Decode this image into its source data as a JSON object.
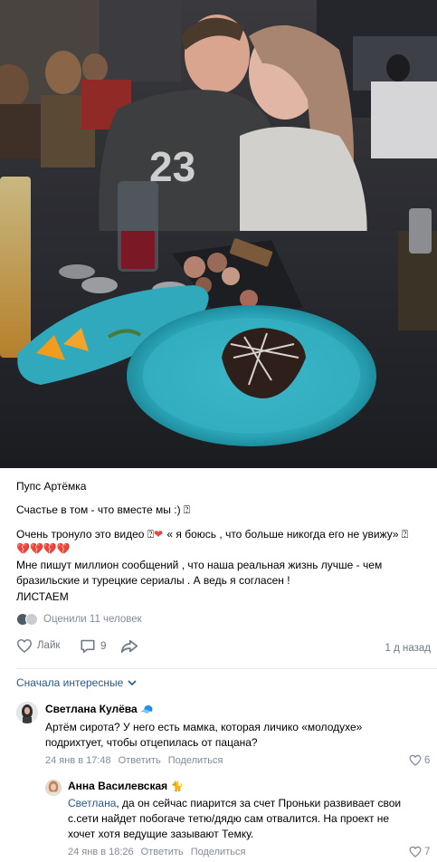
{
  "photo": {
    "alt_icon": "photo-image"
  },
  "post": {
    "author": "Пупс Артёмка",
    "lines": [
      "Счастье в том - что вместе мы :) ⍰",
      "Очень тронуло это видео ⍰",
      "« я боюсь , что больше никогда его не увижу» ⍰",
      "💔💔💔💔",
      "Мне пишут миллион сообщений , что наша реальная жизнь лучше - чем",
      "бразильские и турецкие сериалы . А ведь я согласен !",
      "ЛИСТАЕМ"
    ],
    "likes_summary": "Оценили 11 человек",
    "like_label": "Лайк",
    "comment_count": "9",
    "time": "1 д назад"
  },
  "comments_sort": "Сначала интересные",
  "comments": [
    {
      "name": "Светлана Кулёва",
      "badge": "🧢",
      "text_lines": [
        "Артём сирота? У него есть мамка, которая личико «молодухе»",
        "подрихтует, чтобы отцепилась от пацана?"
      ],
      "date": "24 янв в 17:48",
      "reply": "Ответить",
      "share": "Поделиться",
      "likes": "6"
    },
    {
      "name": "Анна Василевская",
      "badge": "🐈",
      "mention": "Светлана",
      "text_lines": [
        ", да он сейчас пиарится за счет Проньки развивает свои",
        "с.сети найдет побогаче тетю/дядю сам отвалится. На проект не",
        "хочет хотя ведущие зазывают Темку."
      ],
      "date": "24 янв в 18:26",
      "reply": "Ответить",
      "share": "Поделиться",
      "likes": "7"
    }
  ],
  "colors": {
    "link": "#2a5885",
    "meta": "#818c99",
    "icon": "#6d7885",
    "plate": "#35b2c4"
  }
}
